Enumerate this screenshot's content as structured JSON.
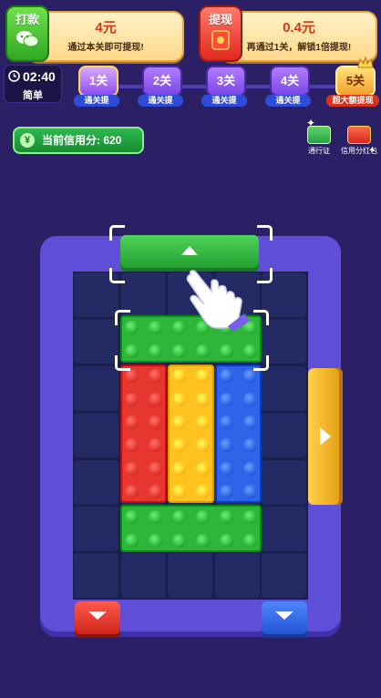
{
  "top_left": {
    "badge_label": "打款",
    "amount": "4元",
    "description": "通过本关即可提现!"
  },
  "top_right": {
    "badge_label": "提现",
    "amount": "0.4元",
    "description": "再通过1关，解锁1倍提现!"
  },
  "timer": {
    "time": "02:40",
    "difficulty": "简单"
  },
  "levels": [
    {
      "label": "1关",
      "sub": "通关提"
    },
    {
      "label": "2关",
      "sub": "通关提"
    },
    {
      "label": "3关",
      "sub": "通关提"
    },
    {
      "label": "4关",
      "sub": "通关提"
    },
    {
      "label": "5关",
      "sub": "超大额提现"
    }
  ],
  "credit": {
    "label": "当前信用分: 620"
  },
  "side_items": [
    {
      "label": "通行证",
      "icon": "pass-ticket-icon"
    },
    {
      "label": "信用分红包",
      "icon": "red-envelope-icon"
    }
  ],
  "board": {
    "rows": 7,
    "cols": 5,
    "blocks": [
      {
        "name": "green-block-top",
        "color": "#2fb53a",
        "rows": 1,
        "cols": 3
      },
      {
        "name": "red-block",
        "color": "#e5362f",
        "rows": 3,
        "cols": 1
      },
      {
        "name": "yellow-block",
        "color": "#ffc21f",
        "rows": 3,
        "cols": 1
      },
      {
        "name": "blue-block",
        "color": "#2f63e8",
        "rows": 3,
        "cols": 1
      },
      {
        "name": "green-block-bottom",
        "color": "#2fb53a",
        "rows": 1,
        "cols": 3
      }
    ],
    "doors": [
      {
        "name": "green-exit-door",
        "color": "#2fb53a",
        "direction": "up"
      },
      {
        "name": "yellow-exit-door",
        "color": "#f4b31a",
        "direction": "right"
      },
      {
        "name": "red-exit-door",
        "color": "#e5362f",
        "direction": "down"
      },
      {
        "name": "blue-exit-door",
        "color": "#2f63e8",
        "direction": "down"
      }
    ]
  },
  "colors": {
    "background": "#2b1f66",
    "board": "#5f4fd8",
    "accent": "#ffd84d"
  }
}
